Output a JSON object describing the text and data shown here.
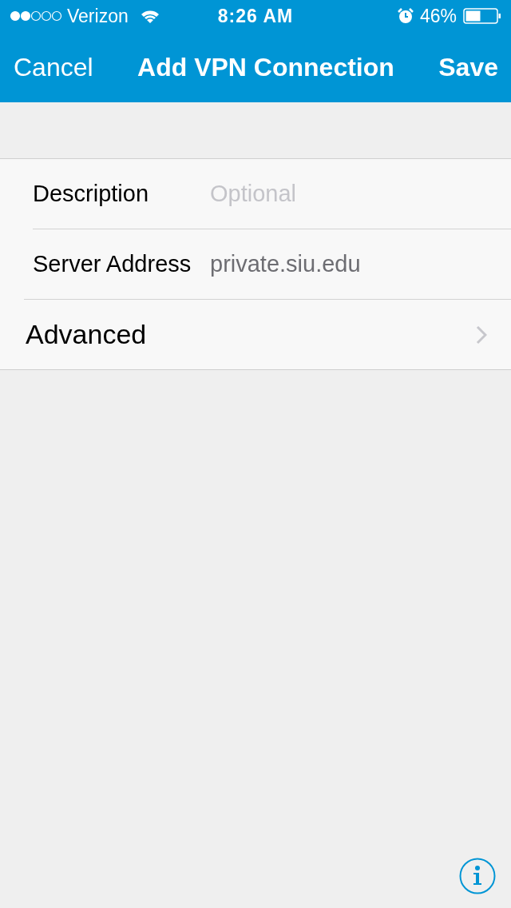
{
  "status_bar": {
    "carrier": "Verizon",
    "time": "8:26 AM",
    "battery": "46%"
  },
  "nav_bar": {
    "cancel": "Cancel",
    "title": "Add VPN Connection",
    "save": "Save"
  },
  "fields": [
    {
      "label": "Description",
      "placeholder": "Optional"
    },
    {
      "label": "Server Address",
      "value": "private.siu.edu"
    }
  ],
  "advanced": {
    "label": "Advanced"
  }
}
